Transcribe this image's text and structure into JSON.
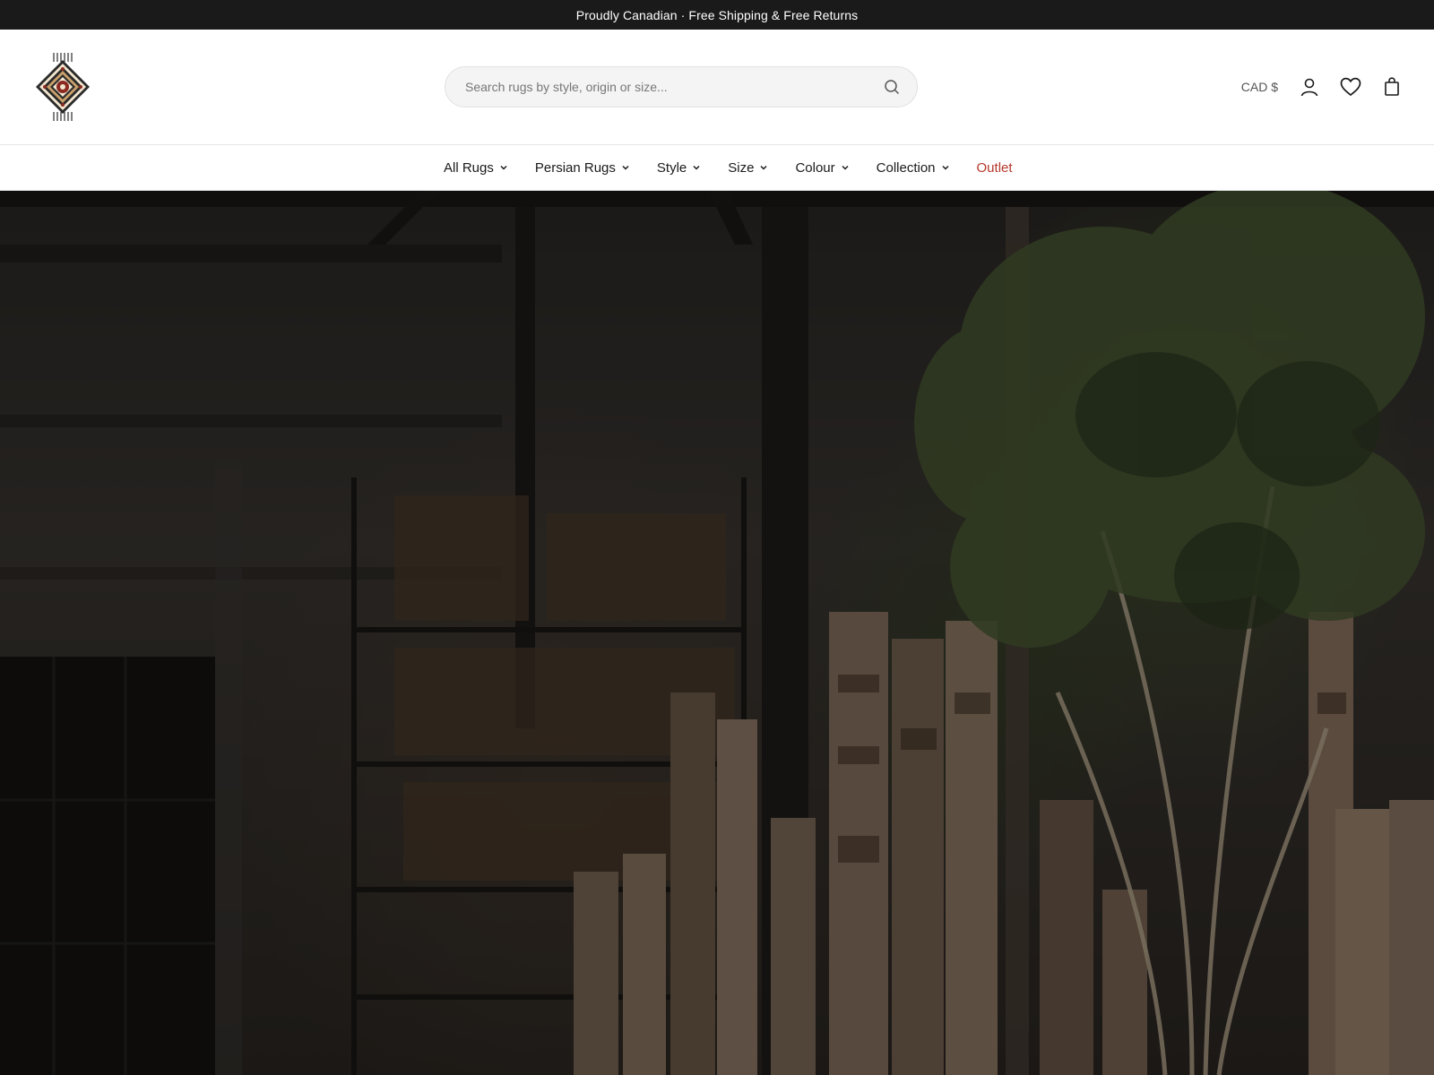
{
  "announcement": {
    "text": "Proudly Canadian · Free Shipping & Free Returns"
  },
  "header": {
    "logo_icon": "persian-medallion-logo-icon",
    "search": {
      "placeholder": "Search rugs by style, origin or size...",
      "value": "",
      "icon": "search-icon"
    },
    "currency": "CAD $",
    "icons": [
      "account-icon",
      "wishlist-heart-icon",
      "shopping-bag-icon"
    ]
  },
  "nav": {
    "items": [
      {
        "label": "All Rugs",
        "has_dropdown": true
      },
      {
        "label": "Persian Rugs",
        "has_dropdown": true
      },
      {
        "label": "Style",
        "has_dropdown": true
      },
      {
        "label": "Size",
        "has_dropdown": true
      },
      {
        "label": "Colour",
        "has_dropdown": true
      },
      {
        "label": "Collection",
        "has_dropdown": true
      },
      {
        "label": "Outlet",
        "has_dropdown": false
      }
    ],
    "outlet_color": "#b5372b"
  },
  "hero": {
    "image_subject": "rolled-rugs-warehouse-with-tree"
  },
  "colors": {
    "announcement_bg": "#1a1a1a",
    "accent_sale": "#b5372b"
  }
}
